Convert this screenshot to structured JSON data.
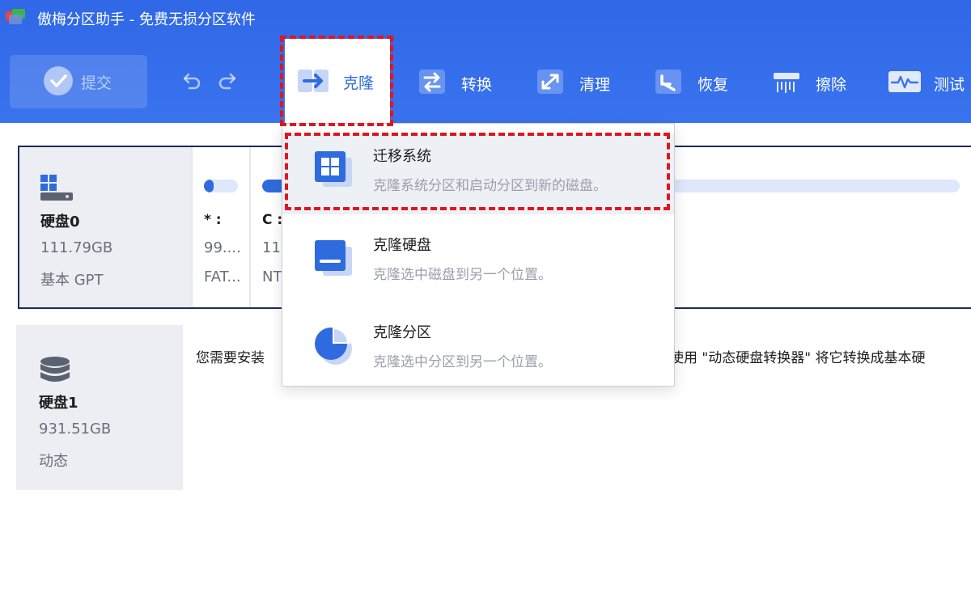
{
  "window": {
    "title": "傲梅分区助手 - 免费无损分区软件"
  },
  "toolbar": {
    "commit_label": "提交",
    "clone_label": "克隆",
    "convert_label": "转换",
    "clean_label": "清理",
    "recover_label": "恢复",
    "wipe_label": "擦除",
    "test_label": "测试"
  },
  "clone_menu": {
    "items": [
      {
        "title": "迁移系统",
        "desc": "克隆系统分区和启动分区到新的磁盘。",
        "icon": "windows-icon"
      },
      {
        "title": "克隆硬盘",
        "desc": "克隆选中磁盘到另一个位置。",
        "icon": "disk-clone-icon"
      },
      {
        "title": "克隆分区",
        "desc": "克隆选中分区到另一个位置。",
        "icon": "partition-clone-icon"
      }
    ]
  },
  "disks": [
    {
      "name": "硬盘0",
      "size": "111.79GB",
      "type": "基本 GPT",
      "partitions": [
        {
          "letter": "* :",
          "size": "99....",
          "fs": "FAT...",
          "used": 0.15
        },
        {
          "letter": "C :",
          "size": "11",
          "fs": "NT",
          "used": 0.4
        }
      ]
    },
    {
      "name": "硬盘1",
      "size": "931.51GB",
      "type": "动态",
      "message_left": "您需要安装",
      "message_right": "使用 \"动态硬盘转换器\" 将它转换成基本硬"
    }
  ],
  "colors": {
    "header_blue": "#3a73ee",
    "accent_blue": "#2f6bdf",
    "highlight_red": "#e0161f",
    "frame_navy": "#1d2a5c"
  }
}
